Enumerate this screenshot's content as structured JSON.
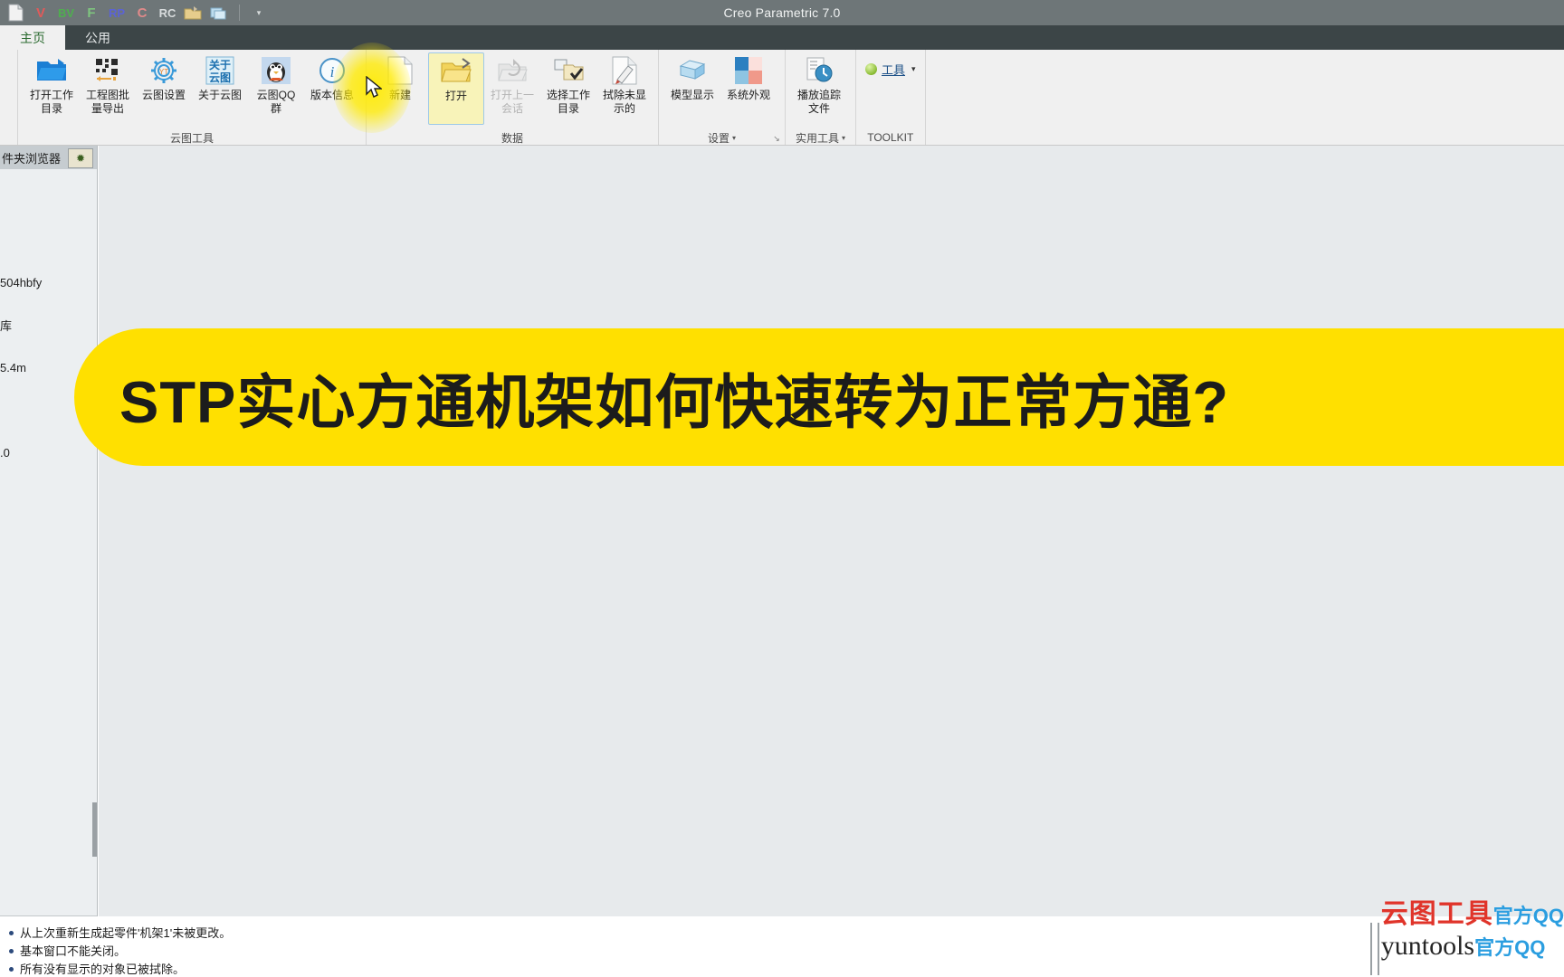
{
  "window": {
    "title": "Creo Parametric 7.0"
  },
  "quick_access": {
    "items": [
      {
        "name": "new-file-icon",
        "glyph": "□",
        "color": "#e8e8e8"
      },
      {
        "name": "v-icon",
        "glyph": "V",
        "color": "#e05a5a"
      },
      {
        "name": "bv-icon",
        "glyph": "BV",
        "color": "#4fae4f"
      },
      {
        "name": "f-icon",
        "glyph": "F",
        "color": "#7ec47e"
      },
      {
        "name": "rp-icon",
        "glyph": "RP",
        "color": "#5b63d6"
      },
      {
        "name": "c-icon",
        "glyph": "C",
        "color": "#e08a8a"
      },
      {
        "name": "rc-icon",
        "glyph": "RC",
        "color": "#d8dcdd"
      },
      {
        "name": "open-folder-icon",
        "glyph": "📁",
        "color": "#d8c27a"
      },
      {
        "name": "windows-icon",
        "glyph": "❐",
        "color": "#9ecde8"
      }
    ],
    "dropdown_caret": "▾"
  },
  "tabs": [
    {
      "label": "主页",
      "active": true
    },
    {
      "label": "公用",
      "active": false
    }
  ],
  "ribbon": {
    "groups": [
      {
        "id": "cloud-tools",
        "title": "云图工具",
        "title_caret": "",
        "has_launcher": false,
        "buttons": [
          {
            "name": "open-work-directory",
            "label": "打开工作\n目录",
            "icon": "blue-open-folder-icon",
            "disabled": false
          },
          {
            "name": "batch-export-drawings",
            "label": "工程图批\n量导出",
            "icon": "qr-grid-icon",
            "disabled": false
          },
          {
            "name": "cloud-settings",
            "label": "云图设置",
            "icon": "gear-yt-icon",
            "disabled": false
          },
          {
            "name": "about-cloud",
            "label": "关于云图",
            "icon": "about-cloud-icon",
            "disabled": false
          },
          {
            "name": "cloud-qq-group",
            "label": "云图QQ\n群",
            "icon": "qq-penguin-icon",
            "disabled": false
          },
          {
            "name": "version-info",
            "label": "版本信息",
            "icon": "info-circle-icon",
            "disabled": false
          }
        ]
      },
      {
        "id": "data",
        "title": "数据",
        "title_caret": "",
        "has_launcher": false,
        "buttons": [
          {
            "name": "new-file-button",
            "label": "新建",
            "icon": "new-document-icon",
            "disabled": false
          },
          {
            "name": "open-file-button",
            "label": "打开",
            "icon": "open-folder-arrow-icon",
            "disabled": false,
            "highlighted": true
          },
          {
            "name": "open-last-session-button",
            "label": "打开上一\n会话",
            "icon": "reopen-session-icon",
            "disabled": true
          },
          {
            "name": "select-work-directory-button",
            "label": "选择工作\n目录",
            "icon": "folder-check-icon",
            "disabled": false
          },
          {
            "name": "erase-not-displayed-button",
            "label": "拭除未显\n示的",
            "icon": "erase-page-icon",
            "disabled": false
          }
        ]
      },
      {
        "id": "settings",
        "title": "设置",
        "title_caret": "▾",
        "has_launcher": true,
        "launcher_glyph": "↘",
        "buttons": [
          {
            "name": "model-display-button",
            "label": "模型显示",
            "icon": "cube-icon",
            "disabled": false
          },
          {
            "name": "system-appearance-button",
            "label": "系统外观",
            "icon": "color-quad-icon",
            "disabled": false
          }
        ]
      },
      {
        "id": "utilities",
        "title": "实用工具",
        "title_caret": "▾",
        "has_launcher": false,
        "buttons": [
          {
            "name": "play-trail-file-button",
            "label": "播放追踪\n文件",
            "icon": "clock-trail-icon",
            "disabled": false
          }
        ]
      }
    ],
    "toolkit": {
      "title": "TOOLKIT",
      "command_label": "工具",
      "command_caret": "▾",
      "orb_color": "#89bb33"
    }
  },
  "left_panel": {
    "header_label": "件夹浏览器",
    "tab_icon": "star-asterisk-icon",
    "rows": [
      {
        "name": "folder-row-1",
        "text": ""
      },
      {
        "name": "folder-row-2",
        "text": ""
      },
      {
        "name": "folder-row-3",
        "text": "504hbfy"
      },
      {
        "name": "folder-row-4",
        "text": "库"
      },
      {
        "name": "folder-row-5",
        "text": "5.4m"
      },
      {
        "name": "folder-row-6",
        "text": ""
      },
      {
        "name": "folder-row-7",
        "text": ".0"
      }
    ]
  },
  "banner": {
    "text": "STP实心方通机架如何快速转为正常方通?",
    "background": "#ffe000",
    "text_color": "#1c1c1c"
  },
  "messages": [
    {
      "name": "status-message-1",
      "text": "从上次重新生成起零件'机架1'未被更改。"
    },
    {
      "name": "status-message-2",
      "text": "基本窗口不能关闭。"
    },
    {
      "name": "status-message-3",
      "text": "所有没有显示的对象已被拭除。"
    }
  ],
  "watermark": {
    "brand_cn": "云图工具",
    "brand_en": "yuntools",
    "qq_line1": "官方QQ",
    "qq_line2": "官方QQ",
    "brand_color": "#e0342a",
    "qq_color": "#2b9ee0"
  }
}
